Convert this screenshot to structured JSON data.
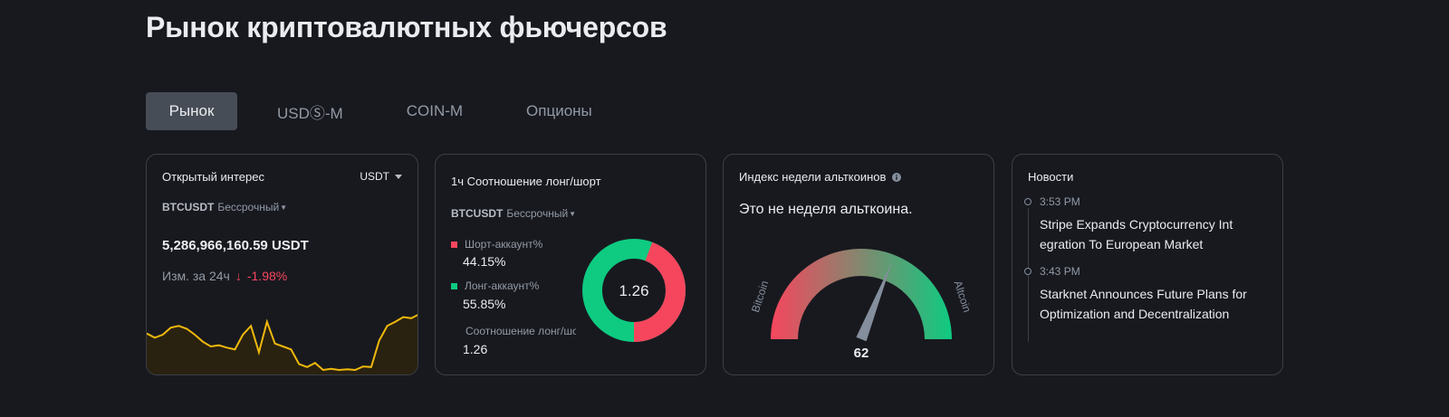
{
  "page": {
    "title": "Рынок криптовалютных фьючерсов"
  },
  "tabs": [
    {
      "label": "Рынок",
      "active": true
    },
    {
      "label": "USDⓈ-M",
      "active": false
    },
    {
      "label": "COIN-M",
      "active": false
    },
    {
      "label": "Опционы",
      "active": false
    }
  ],
  "open_interest": {
    "title": "Открытый интерес",
    "unit": "USDT",
    "symbol": "BTCUSDT",
    "contract": "Бессрочный",
    "value": "5,286,966,160.59 USDT",
    "change_label": "Изм. за 24ч",
    "change_arrow": "↓",
    "change_value": "-1.98%",
    "sparkline": [
      0.62,
      0.55,
      0.6,
      0.72,
      0.75,
      0.7,
      0.6,
      0.48,
      0.4,
      0.42,
      0.38,
      0.35,
      0.6,
      0.75,
      0.3,
      0.82,
      0.45,
      0.4,
      0.35,
      0.1,
      0.05,
      0.12,
      0.0,
      0.02,
      0.0,
      0.01,
      0.0,
      0.06,
      0.05,
      0.5,
      0.75,
      0.82,
      0.9,
      0.88,
      0.95
    ],
    "colors": {
      "line": "#f0b90b",
      "fill": "#2a2210",
      "negative": "#f6465d"
    }
  },
  "long_short": {
    "title": "1ч Соотношение лонг/шорт",
    "symbol": "BTCUSDT",
    "contract": "Бессрочный",
    "short_label": "Шорт-аккаунт%",
    "short_value": "44.15%",
    "short_pct": 44.15,
    "long_label": "Лонг-аккаунт%",
    "long_value": "55.85%",
    "long_pct": 55.85,
    "ratio_label": "Соотношение лонг/шорт",
    "ratio_value": "1.26",
    "center_value": "1.26",
    "colors": {
      "short": "#f6465d",
      "long": "#0ecb81"
    }
  },
  "altcoin_season": {
    "title": "Индекс недели альткоинов",
    "message": "Это не неделя альткоина.",
    "left_label": "Bitcoin",
    "right_label": "Altcoin",
    "value": "62",
    "level": 62,
    "colors": {
      "start": "#f6465d",
      "end": "#0ecb81",
      "needle": "#848e9c"
    }
  },
  "news": {
    "title": "Новости",
    "items": [
      {
        "time": "3:53 PM",
        "headline": "Stripe Expands Cryptocurrency Int egration To European Market"
      },
      {
        "time": "3:43 PM",
        "headline": "Starknet Announces Future Plans for Optimization and Decentralization"
      }
    ]
  }
}
